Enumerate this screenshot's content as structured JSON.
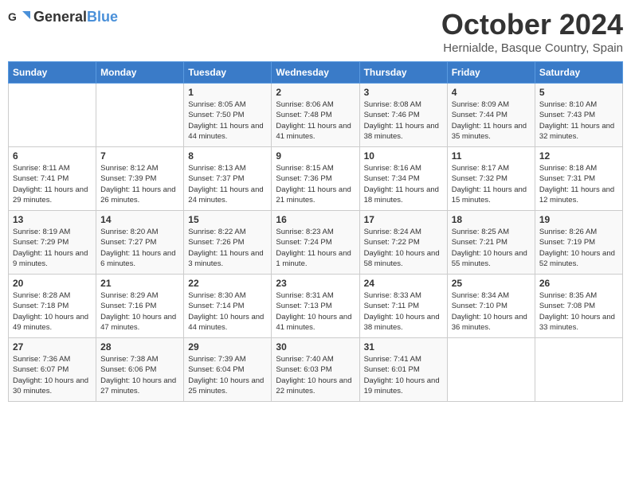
{
  "header": {
    "logo_general": "General",
    "logo_blue": "Blue",
    "month_title": "October 2024",
    "location": "Hernialde, Basque Country, Spain"
  },
  "weekdays": [
    "Sunday",
    "Monday",
    "Tuesday",
    "Wednesday",
    "Thursday",
    "Friday",
    "Saturday"
  ],
  "weeks": [
    [
      {
        "day": "",
        "detail": ""
      },
      {
        "day": "",
        "detail": ""
      },
      {
        "day": "1",
        "detail": "Sunrise: 8:05 AM\nSunset: 7:50 PM\nDaylight: 11 hours and 44 minutes."
      },
      {
        "day": "2",
        "detail": "Sunrise: 8:06 AM\nSunset: 7:48 PM\nDaylight: 11 hours and 41 minutes."
      },
      {
        "day": "3",
        "detail": "Sunrise: 8:08 AM\nSunset: 7:46 PM\nDaylight: 11 hours and 38 minutes."
      },
      {
        "day": "4",
        "detail": "Sunrise: 8:09 AM\nSunset: 7:44 PM\nDaylight: 11 hours and 35 minutes."
      },
      {
        "day": "5",
        "detail": "Sunrise: 8:10 AM\nSunset: 7:43 PM\nDaylight: 11 hours and 32 minutes."
      }
    ],
    [
      {
        "day": "6",
        "detail": "Sunrise: 8:11 AM\nSunset: 7:41 PM\nDaylight: 11 hours and 29 minutes."
      },
      {
        "day": "7",
        "detail": "Sunrise: 8:12 AM\nSunset: 7:39 PM\nDaylight: 11 hours and 26 minutes."
      },
      {
        "day": "8",
        "detail": "Sunrise: 8:13 AM\nSunset: 7:37 PM\nDaylight: 11 hours and 24 minutes."
      },
      {
        "day": "9",
        "detail": "Sunrise: 8:15 AM\nSunset: 7:36 PM\nDaylight: 11 hours and 21 minutes."
      },
      {
        "day": "10",
        "detail": "Sunrise: 8:16 AM\nSunset: 7:34 PM\nDaylight: 11 hours and 18 minutes."
      },
      {
        "day": "11",
        "detail": "Sunrise: 8:17 AM\nSunset: 7:32 PM\nDaylight: 11 hours and 15 minutes."
      },
      {
        "day": "12",
        "detail": "Sunrise: 8:18 AM\nSunset: 7:31 PM\nDaylight: 11 hours and 12 minutes."
      }
    ],
    [
      {
        "day": "13",
        "detail": "Sunrise: 8:19 AM\nSunset: 7:29 PM\nDaylight: 11 hours and 9 minutes."
      },
      {
        "day": "14",
        "detail": "Sunrise: 8:20 AM\nSunset: 7:27 PM\nDaylight: 11 hours and 6 minutes."
      },
      {
        "day": "15",
        "detail": "Sunrise: 8:22 AM\nSunset: 7:26 PM\nDaylight: 11 hours and 3 minutes."
      },
      {
        "day": "16",
        "detail": "Sunrise: 8:23 AM\nSunset: 7:24 PM\nDaylight: 11 hours and 1 minute."
      },
      {
        "day": "17",
        "detail": "Sunrise: 8:24 AM\nSunset: 7:22 PM\nDaylight: 10 hours and 58 minutes."
      },
      {
        "day": "18",
        "detail": "Sunrise: 8:25 AM\nSunset: 7:21 PM\nDaylight: 10 hours and 55 minutes."
      },
      {
        "day": "19",
        "detail": "Sunrise: 8:26 AM\nSunset: 7:19 PM\nDaylight: 10 hours and 52 minutes."
      }
    ],
    [
      {
        "day": "20",
        "detail": "Sunrise: 8:28 AM\nSunset: 7:18 PM\nDaylight: 10 hours and 49 minutes."
      },
      {
        "day": "21",
        "detail": "Sunrise: 8:29 AM\nSunset: 7:16 PM\nDaylight: 10 hours and 47 minutes."
      },
      {
        "day": "22",
        "detail": "Sunrise: 8:30 AM\nSunset: 7:14 PM\nDaylight: 10 hours and 44 minutes."
      },
      {
        "day": "23",
        "detail": "Sunrise: 8:31 AM\nSunset: 7:13 PM\nDaylight: 10 hours and 41 minutes."
      },
      {
        "day": "24",
        "detail": "Sunrise: 8:33 AM\nSunset: 7:11 PM\nDaylight: 10 hours and 38 minutes."
      },
      {
        "day": "25",
        "detail": "Sunrise: 8:34 AM\nSunset: 7:10 PM\nDaylight: 10 hours and 36 minutes."
      },
      {
        "day": "26",
        "detail": "Sunrise: 8:35 AM\nSunset: 7:08 PM\nDaylight: 10 hours and 33 minutes."
      }
    ],
    [
      {
        "day": "27",
        "detail": "Sunrise: 7:36 AM\nSunset: 6:07 PM\nDaylight: 10 hours and 30 minutes."
      },
      {
        "day": "28",
        "detail": "Sunrise: 7:38 AM\nSunset: 6:06 PM\nDaylight: 10 hours and 27 minutes."
      },
      {
        "day": "29",
        "detail": "Sunrise: 7:39 AM\nSunset: 6:04 PM\nDaylight: 10 hours and 25 minutes."
      },
      {
        "day": "30",
        "detail": "Sunrise: 7:40 AM\nSunset: 6:03 PM\nDaylight: 10 hours and 22 minutes."
      },
      {
        "day": "31",
        "detail": "Sunrise: 7:41 AM\nSunset: 6:01 PM\nDaylight: 10 hours and 19 minutes."
      },
      {
        "day": "",
        "detail": ""
      },
      {
        "day": "",
        "detail": ""
      }
    ]
  ]
}
